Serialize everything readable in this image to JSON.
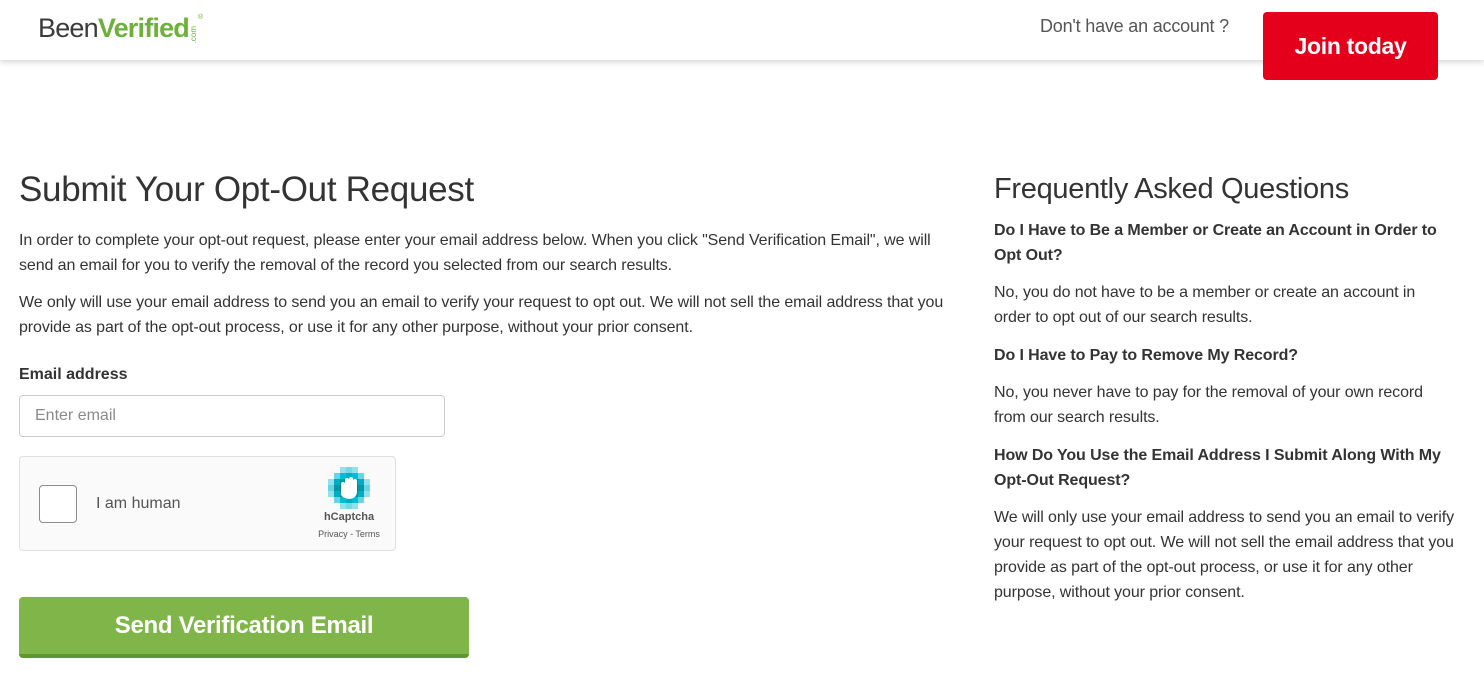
{
  "header": {
    "logo": {
      "part1": "Been",
      "part2": "Verified",
      "suffix": ".com",
      "reg": "®"
    },
    "account_question": "Don't have an account ?",
    "join_button": "Join today"
  },
  "form": {
    "title": "Submit Your Opt-Out Request",
    "paragraph1": "In order to complete your opt-out request, please enter your email address below. When you click \"Send Verification Email\", we will send an email for you to verify the removal of the record you selected from our search results.",
    "paragraph2": "We only will use your email address to send you an email to verify your request to opt out. We will not sell the email address that you provide as part of the opt-out process, or use it for any other purpose, without your prior consent.",
    "email_label": "Email address",
    "email_placeholder": "Enter email",
    "email_value": "",
    "captcha": {
      "label": "I am human",
      "brand": "hCaptcha",
      "links": "Privacy - Terms",
      "checked": false
    },
    "submit_button": "Send Verification Email"
  },
  "faq": {
    "title": "Frequently Asked Questions",
    "items": [
      {
        "question": "Do I Have to Be a Member or Create an Account in Order to Opt Out?",
        "answer": "No, you do not have to be a member or create an account in order to opt out of our search results."
      },
      {
        "question": "Do I Have to Pay to Remove My Record?",
        "answer": "No, you never have to pay for the removal of your own record from our search results."
      },
      {
        "question": "How Do You Use the Email Address I Submit Along With My Opt-Out Request?",
        "answer": "We will only use your email address to send you an email to verify your request to opt out. We will not sell the email address that you provide as part of the opt-out process, or use it for any other purpose, without your prior consent."
      }
    ]
  },
  "colors": {
    "brand_green": "#6fb03c",
    "join_red": "#e4001b",
    "send_green": "#80b54a",
    "captcha_teal": "#00bcd4"
  }
}
